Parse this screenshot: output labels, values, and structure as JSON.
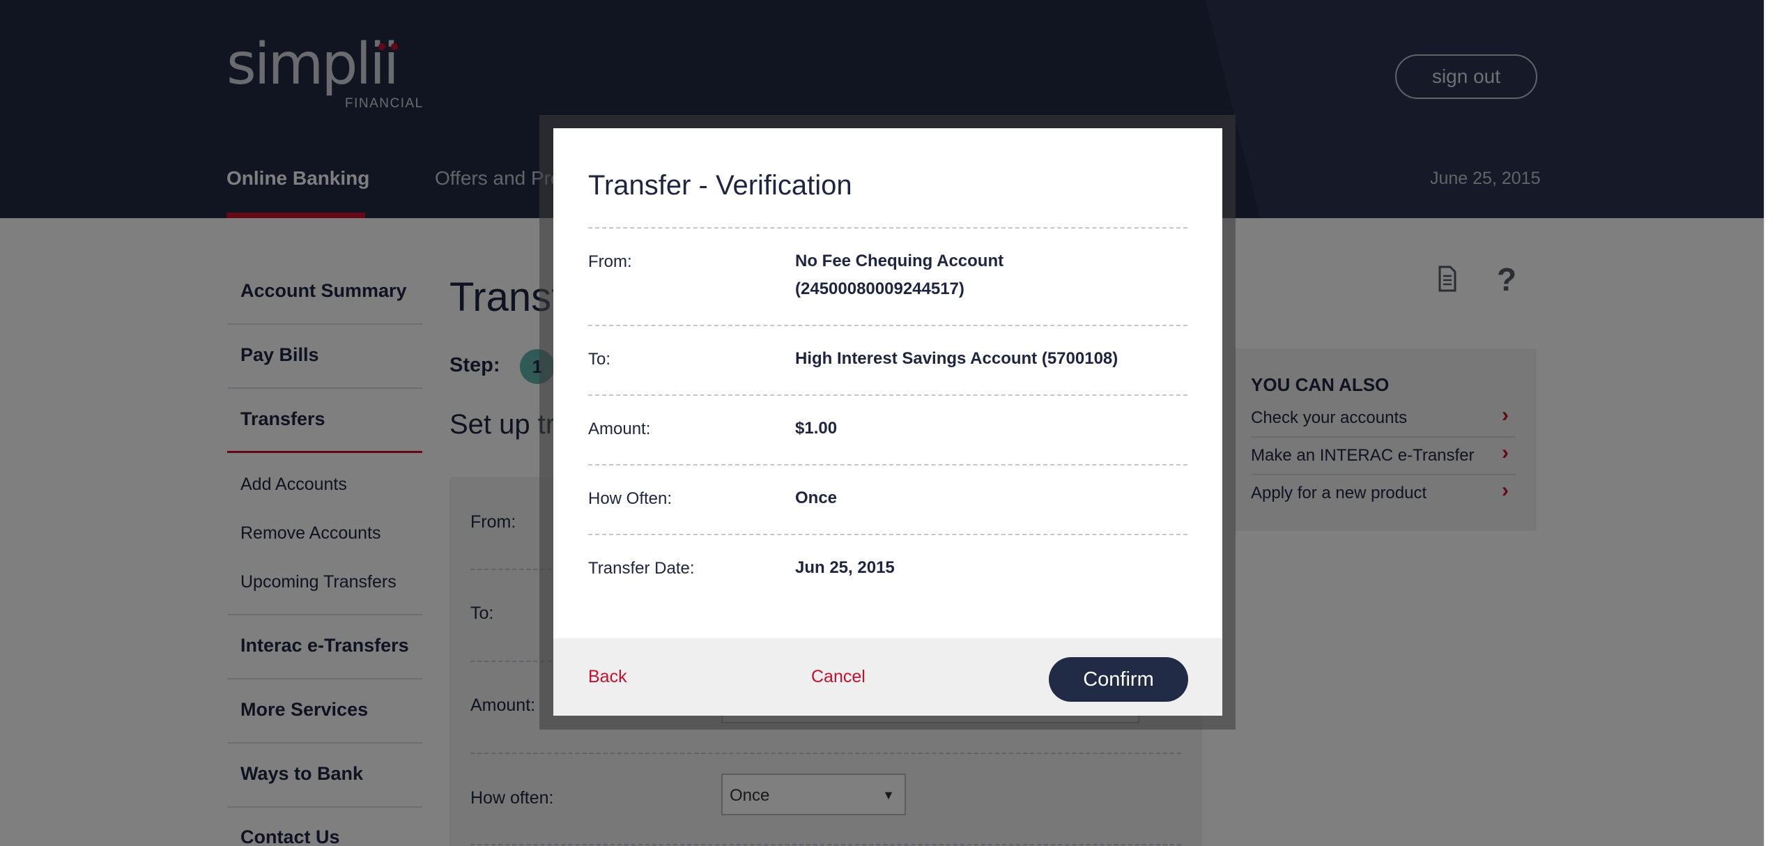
{
  "header": {
    "logo_word": "simplii",
    "logo_sub": "FINANCIAL",
    "sign_out": "sign out",
    "nav_active": "Online Banking",
    "nav_offers": "Offers and Pro",
    "date": "June 25, 2015"
  },
  "sidebar": {
    "items": [
      {
        "label": "Account Summary"
      },
      {
        "label": "Pay Bills"
      },
      {
        "label": "Transfers"
      },
      {
        "label": "Add Accounts"
      },
      {
        "label": "Remove Accounts"
      },
      {
        "label": "Upcoming Transfers"
      },
      {
        "label": "Interac e-Transfers"
      },
      {
        "label": "More Services"
      },
      {
        "label": "Ways to Bank"
      },
      {
        "label": "Contact Us"
      }
    ]
  },
  "main": {
    "title": "Transfe",
    "step_label": "Step:",
    "step_number": "1",
    "setup_title": "Set up tr",
    "form": {
      "from_label": "From:",
      "to_label": "To:",
      "amount_label": "Amount:",
      "how_often_label": "How often:",
      "how_often_value": "Once",
      "dropdown_arrow": "▼"
    }
  },
  "tools": {
    "help_glyph": "?"
  },
  "you_can_also": {
    "title": "YOU CAN ALSO",
    "links": [
      {
        "label": "Check your accounts"
      },
      {
        "label": "Make an INTERAC e-Transfer"
      },
      {
        "label": "Apply for a new product"
      }
    ],
    "chevron": "›"
  },
  "modal": {
    "title": "Transfer - Verification",
    "rows": [
      {
        "label": "From:",
        "value": "No Fee Chequing Account",
        "value2": "(24500080009244517)"
      },
      {
        "label": "To:",
        "value": "High Interest Savings Account (5700108)"
      },
      {
        "label": "Amount:",
        "value": "$1.00"
      },
      {
        "label": "How Often:",
        "value": "Once"
      },
      {
        "label": "Transfer Date:",
        "value": "Jun 25, 2015"
      }
    ],
    "back": "Back",
    "cancel": "Cancel",
    "confirm": "Confirm"
  },
  "colors": {
    "navy": "#222b45",
    "accent_red": "#c8102e",
    "step_teal": "#5fb4aa"
  }
}
